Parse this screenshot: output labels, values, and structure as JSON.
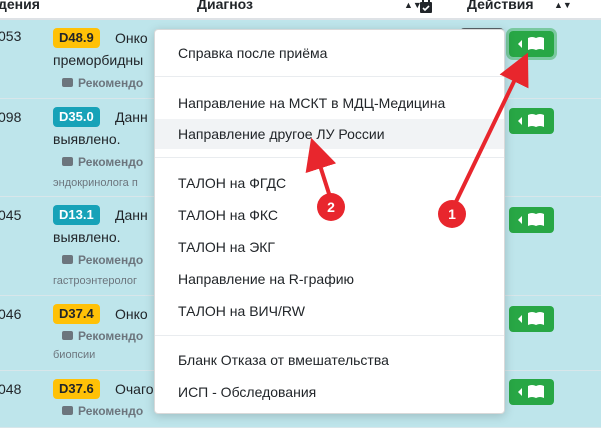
{
  "header": {
    "col_date": "дения",
    "col_diagnosis": "Диагноз",
    "col_actions": "Действия",
    "sort_glyph": "▲▼"
  },
  "rows": [
    {
      "num": "053",
      "code": "D48.9",
      "code_color": "yellow",
      "diagnosis": "Онко",
      "line2": "преморбидны",
      "rec": "Рекомендо",
      "sub": ""
    },
    {
      "num": "098",
      "code": "D35.0",
      "code_color": "teal",
      "diagnosis": "Данн",
      "line2": "выявлено.",
      "rec": "Рекомендо",
      "sub": "эндокринолога п"
    },
    {
      "num": "045",
      "code": "D13.1",
      "code_color": "teal",
      "diagnosis": "Данн",
      "line2": "выявлено.",
      "rec": "Рекомендо",
      "sub": "гастроэнтеролог"
    },
    {
      "num": "046",
      "code": "D37.4",
      "code_color": "yellow",
      "diagnosis": "Онко",
      "line2": "",
      "rec": "Рекомендо",
      "sub": "биопсии"
    },
    {
      "num": "048",
      "code": "D37.6",
      "code_color": "yellow",
      "diagnosis": "Очаго",
      "line2": "",
      "rec": "Рекомендо",
      "sub": ""
    }
  ],
  "dropdown": {
    "items": [
      "Справка после приёма",
      "Направление на МСКТ в МДЦ-Медицина",
      "Направление другое ЛУ России",
      "ТАЛОН на ФГДС",
      "ТАЛОН на ФКС",
      "ТАЛОН на ЭКГ",
      "Направление на R-графию",
      "ТАЛОН на ВИЧ/RW",
      "Бланк Отказа от вмешательства",
      "ИСП - Обследования"
    ]
  },
  "annotations": {
    "marker_1": "1",
    "marker_2": "2",
    "color": "#e8262d"
  },
  "icons": [
    "calendar-check-icon",
    "book-icon",
    "caret-left-icon",
    "comment-icon"
  ]
}
